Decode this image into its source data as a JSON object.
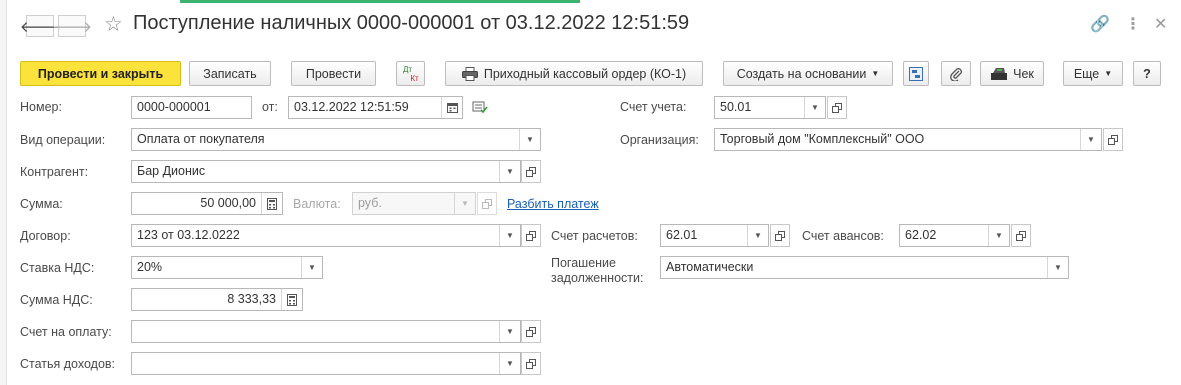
{
  "window": {
    "title": "Поступление наличных 0000-000001 от 03.12.2022 12:51:59",
    "back_glyph": "🡐",
    "forward_glyph": "🡒",
    "star_glyph": "☆",
    "link_glyph": "🔗",
    "menu_glyph": "⋮",
    "close_glyph": "✕"
  },
  "toolbar": {
    "post_close": "Провести и закрыть",
    "save": "Записать",
    "post": "Провести",
    "dt_label": "Дт",
    "kt_label": "Кт",
    "print_order": "Приходный кассовый ордер (КО-1)",
    "create_based": "Создать на основании",
    "receipt": "Чек",
    "more": "Еще",
    "help": "?"
  },
  "form": {
    "number_label": "Номер:",
    "number_value": "0000-000001",
    "from_label": "от:",
    "date_value": "03.12.2022 12:51:59",
    "account_label": "Счет учета:",
    "account_value": "50.01",
    "operation_label": "Вид операции:",
    "operation_value": "Оплата от покупателя",
    "organization_label": "Организация:",
    "organization_value": "Торговый дом \"Комплексный\" ООО",
    "counterparty_label": "Контрагент:",
    "counterparty_value": "Бар Дионис",
    "sum_label": "Сумма:",
    "sum_value": "50 000,00",
    "currency_label": "Валюта:",
    "currency_value": "руб.",
    "split_payment_link": "Разбить платеж",
    "contract_label": "Договор:",
    "contract_value": "123 от 03.12.0222",
    "settlement_account_label": "Счет расчетов:",
    "settlement_account_value": "62.01",
    "advance_account_label": "Счет авансов:",
    "advance_account_value": "62.02",
    "vat_rate_label": "Ставка НДС:",
    "vat_rate_value": "20%",
    "debt_repayment_label_1": "Погашение",
    "debt_repayment_label_2": "задолженности:",
    "debt_repayment_value": "Автоматически",
    "vat_sum_label": "Сумма НДС:",
    "vat_sum_value": "8 333,33",
    "invoice_label": "Счет на оплату:",
    "invoice_value": "",
    "income_item_label": "Статья доходов:",
    "income_item_value": ""
  },
  "colors": {
    "primary_button": "#fce33b",
    "link": "#1a5fb4",
    "top_accent": "#3cb371"
  }
}
